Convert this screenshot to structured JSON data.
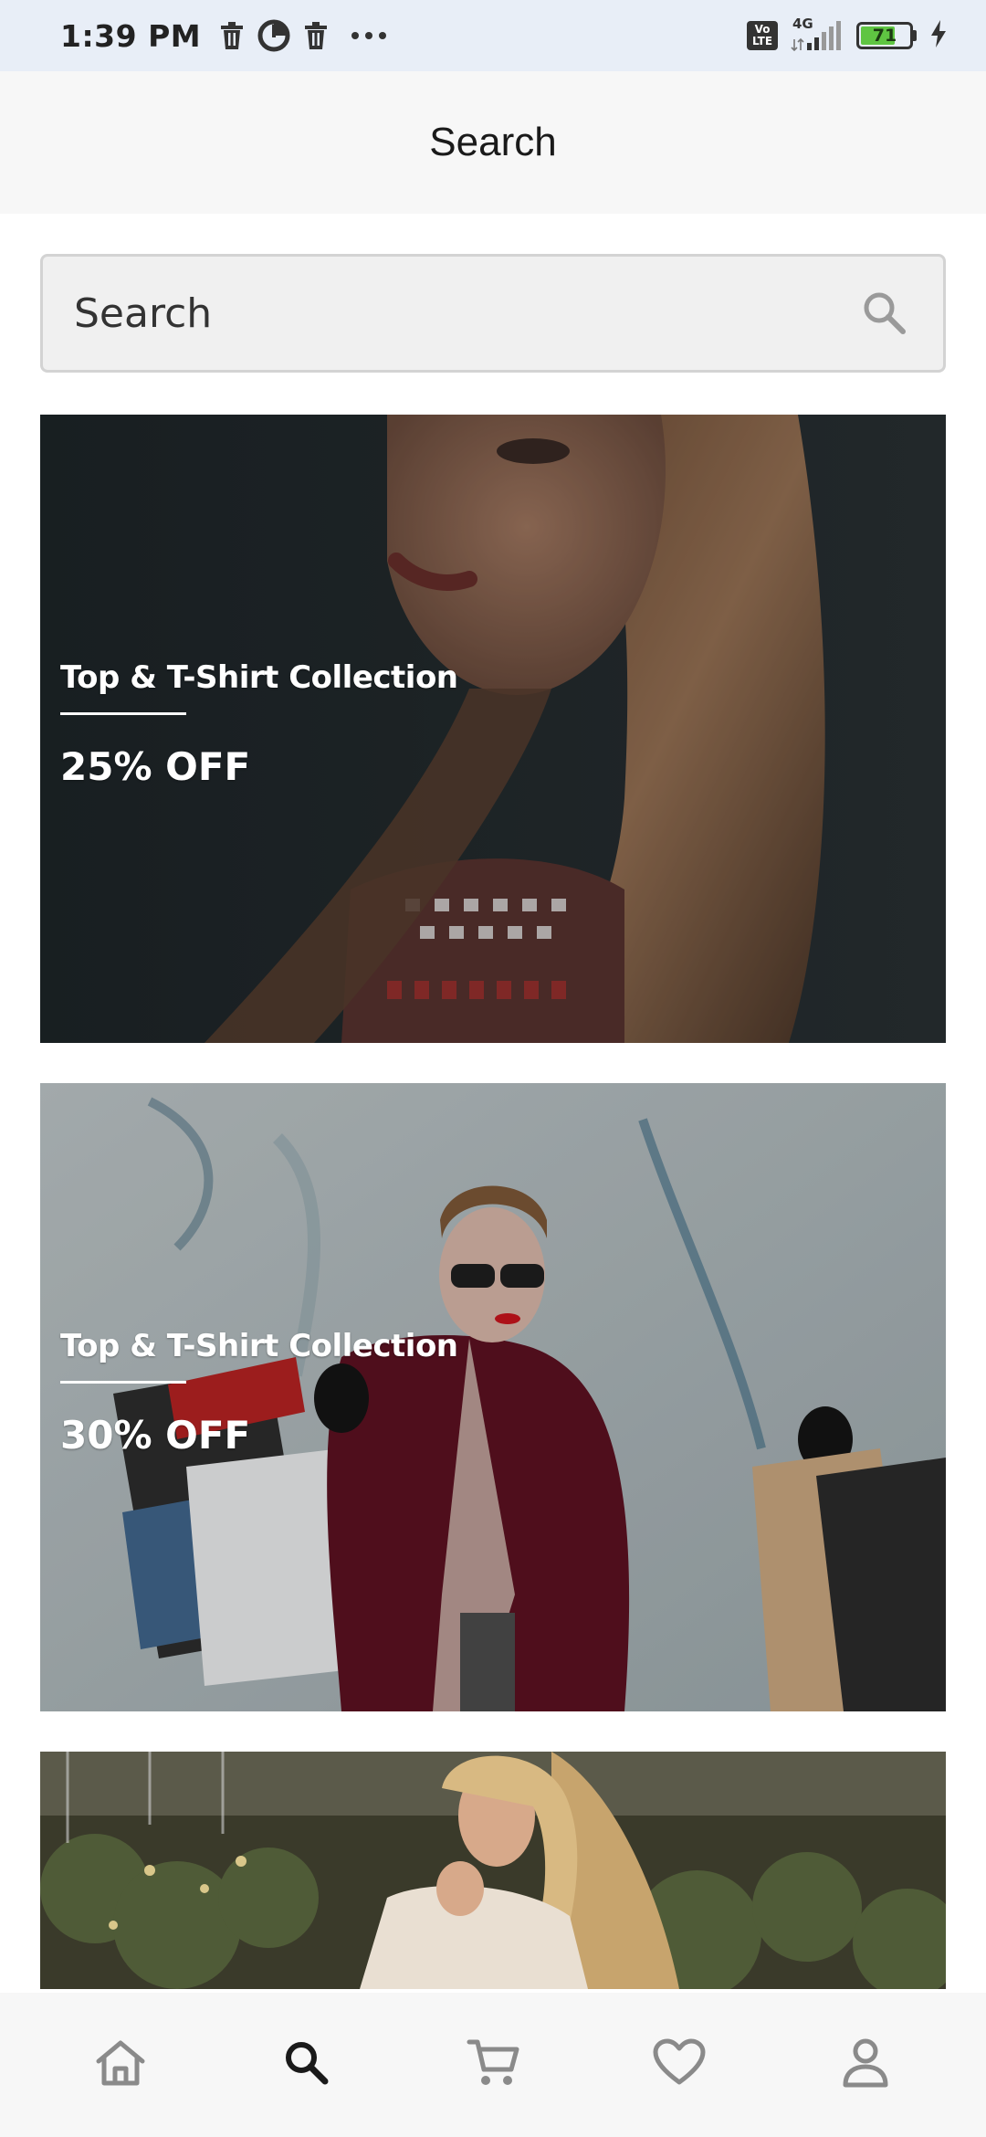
{
  "status_bar": {
    "time": "1:39 PM",
    "left_icons": [
      "trash-icon",
      "sync-icon",
      "trash-icon",
      "more-dots-icon"
    ],
    "volte_label_top": "Vo",
    "volte_label_bottom": "LTE",
    "network": "4G",
    "battery_level": "71",
    "battery_fraction": 0.71,
    "charging_icon": "bolt-icon"
  },
  "header": {
    "title": "Search"
  },
  "search": {
    "placeholder": "Search",
    "icon": "search-icon"
  },
  "banners": [
    {
      "title": "Top & T-Shirt Collection",
      "discount": "25% OFF"
    },
    {
      "title": "Top & T-Shirt Collection",
      "discount": "30% OFF"
    },
    {
      "title": "",
      "discount": ""
    }
  ],
  "bottom_nav": {
    "items": [
      {
        "name": "home",
        "icon": "home-icon",
        "active": false
      },
      {
        "name": "search",
        "icon": "search-icon",
        "active": true
      },
      {
        "name": "cart",
        "icon": "cart-icon",
        "active": false
      },
      {
        "name": "favorites",
        "icon": "heart-icon",
        "active": false
      },
      {
        "name": "profile",
        "icon": "user-icon",
        "active": false
      }
    ]
  },
  "colors": {
    "status_bar_bg": "#e8eef7",
    "header_bg": "#f7f7f7",
    "active_icon": "#1a1a1a",
    "inactive_icon": "#8a8a8a",
    "battery_fill": "#5fc542"
  }
}
